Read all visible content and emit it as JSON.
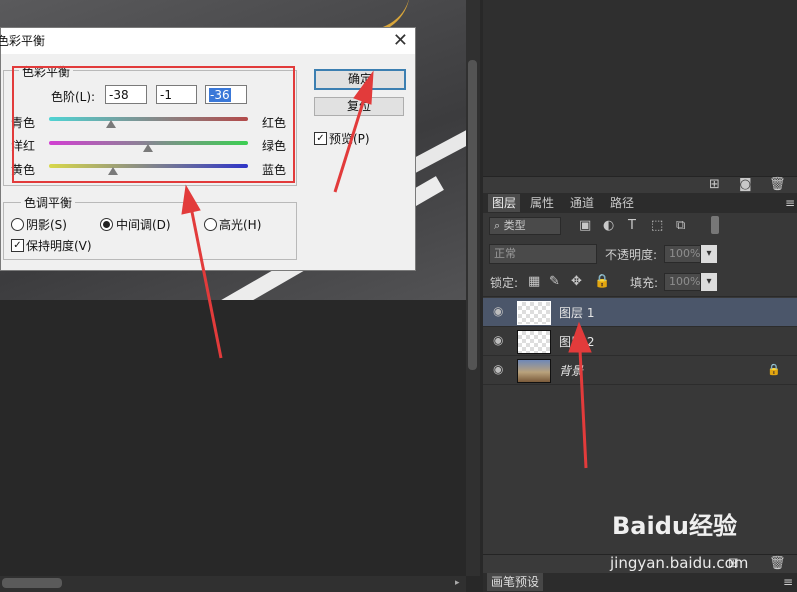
{
  "dialog": {
    "title": "色彩平衡",
    "group_color_balance": "色彩平衡",
    "levels_label": "色阶(L):",
    "levels": [
      "-38",
      "-1",
      "-36"
    ],
    "sliders": [
      {
        "left": "青色",
        "right": "红色",
        "value": -38
      },
      {
        "left": "洋红",
        "right": "绿色",
        "value": -1
      },
      {
        "left": "黄色",
        "right": "蓝色",
        "value": -36
      }
    ],
    "ok_label": "确定",
    "reset_label": "复位",
    "preview_label": "预览(P)",
    "group_tone_balance": "色调平衡",
    "tone_options": [
      "阴影(S)",
      "中间调(D)",
      "高光(H)"
    ],
    "tone_selected": "中间调(D)",
    "preserve_label": "保持明度(V)",
    "preserve_checked": true,
    "preview_checked": true
  },
  "panels": {
    "tabs": [
      "图层",
      "属性",
      "通道",
      "路径"
    ],
    "active_tab": "图层",
    "filter_label": "类型",
    "blend_mode": "正常",
    "opacity_label": "不透明度:",
    "opacity_value": "100%",
    "lock_label": "锁定:",
    "fill_label": "填充:",
    "fill_value": "100%",
    "layers": [
      {
        "name": "图层 1",
        "selected": true,
        "kind": "transparent"
      },
      {
        "name": "图层 2",
        "selected": false,
        "kind": "transparent"
      },
      {
        "name": "背景",
        "selected": false,
        "kind": "photo",
        "locked": true
      }
    ],
    "brush_presets_tab": "画笔预设"
  },
  "watermark": {
    "brand": "Baidu经验",
    "url": "jingyan.baidu.com"
  },
  "colors": {
    "accent_red": "#e23b3b",
    "panel_bg": "#383838",
    "selected_layer": "#4b566a"
  }
}
